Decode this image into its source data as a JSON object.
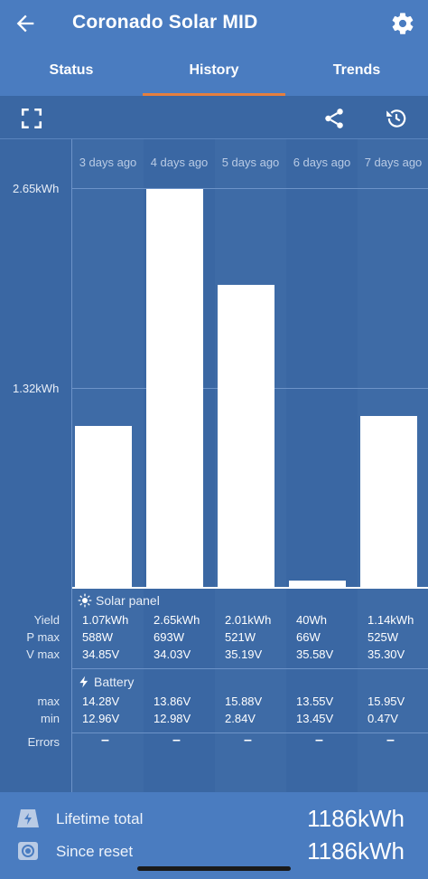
{
  "header": {
    "title": "Coronado Solar MID",
    "back_icon": "arrow-left-icon",
    "settings_icon": "gear-icon"
  },
  "tabs": [
    {
      "label": "Status",
      "active": false
    },
    {
      "label": "History",
      "active": true
    },
    {
      "label": "Trends",
      "active": false
    }
  ],
  "toolbar": {
    "fullscreen_icon": "fullscreen-icon",
    "share_icon": "share-icon",
    "history_icon": "history-icon"
  },
  "colors": {
    "appbar": "#4a7cc0",
    "background": "#3a67a3",
    "tab_indicator": "#e57f3e"
  },
  "chart_data": {
    "type": "bar",
    "categories": [
      "3 days ago",
      "4 days ago",
      "5 days ago",
      "6 days ago",
      "7 days ago"
    ],
    "values": [
      1.07,
      2.65,
      2.01,
      0.04,
      1.14
    ],
    "y_ticks": [
      "2.65kWh",
      "1.32kWh"
    ],
    "y_tick_values": [
      2.65,
      1.32
    ],
    "ylim": [
      0,
      2.65
    ],
    "grid": true
  },
  "table": {
    "solar_title": "Solar panel",
    "battery_title": "Battery",
    "labels": {
      "yield": "Yield",
      "pmax": "P max",
      "vmax": "V max",
      "bmax": "max",
      "bmin": "min",
      "errors": "Errors"
    },
    "yield": [
      "1.07kWh",
      "2.65kWh",
      "2.01kWh",
      "40Wh",
      "1.14kWh"
    ],
    "pmax": [
      "588W",
      "693W",
      "521W",
      "66W",
      "525W"
    ],
    "vmax": [
      "34.85V",
      "34.03V",
      "35.19V",
      "35.58V",
      "35.30V"
    ],
    "bmax": [
      "14.28V",
      "13.86V",
      "15.88V",
      "13.55V",
      "15.95V"
    ],
    "bmin": [
      "12.96V",
      "12.98V",
      "2.84V",
      "13.45V",
      "0.47V"
    ],
    "errors": [
      "–",
      "–",
      "–",
      "–",
      "–"
    ]
  },
  "footer": {
    "lifetime_label": "Lifetime total",
    "lifetime_value": "1186kWh",
    "reset_label": "Since reset",
    "reset_value": "1186kWh"
  }
}
